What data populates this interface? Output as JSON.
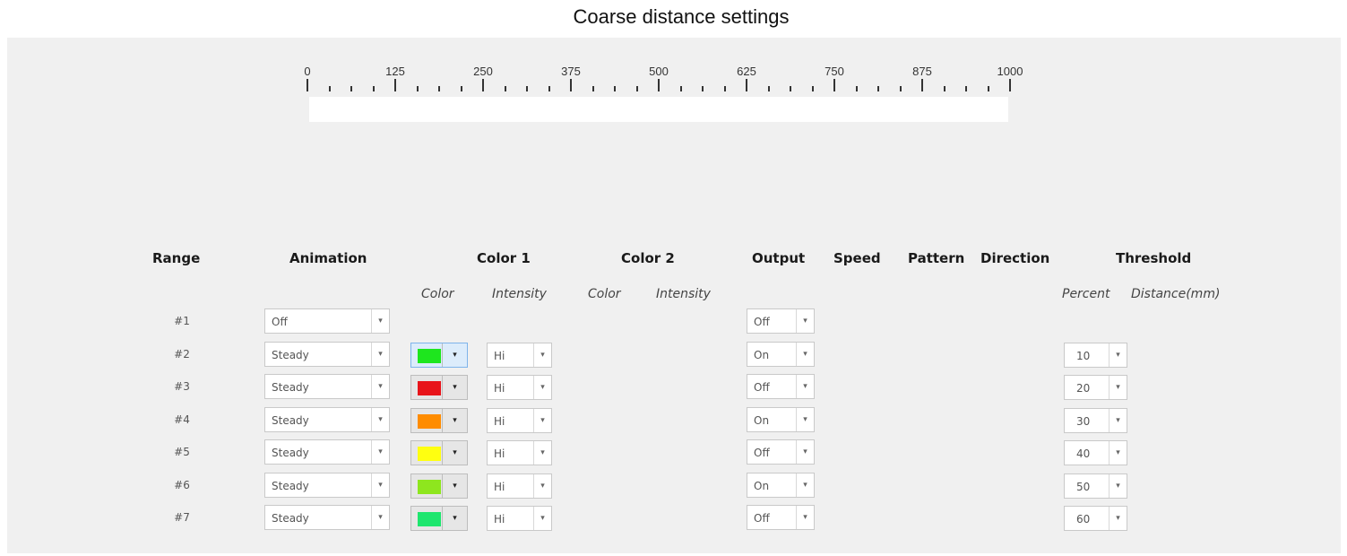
{
  "title": "Coarse distance settings",
  "ruler": {
    "labels": [
      "0",
      "125",
      "250",
      "375",
      "500",
      "625",
      "750",
      "875",
      "1000"
    ],
    "minor_per_major": 3
  },
  "headers": {
    "range": "Range",
    "animation": "Animation",
    "color1": "Color 1",
    "color2": "Color 2",
    "output": "Output",
    "speed": "Speed",
    "pattern": "Pattern",
    "direction": "Direction",
    "threshold": "Threshold"
  },
  "subheaders": {
    "c1_color": "Color",
    "c1_intensity": "Intensity",
    "c2_color": "Color",
    "c2_intensity": "Intensity",
    "percent": "Percent",
    "distance": "Distance(mm)"
  },
  "rows": [
    {
      "label": "#1",
      "animation": "Off",
      "output": "Off"
    },
    {
      "label": "#2",
      "animation": "Steady",
      "color": "#1ee61e",
      "intensity": "Hi",
      "output": "On",
      "percent": "10",
      "active": true
    },
    {
      "label": "#3",
      "animation": "Steady",
      "color": "#e8141a",
      "intensity": "Hi",
      "output": "Off",
      "percent": "20"
    },
    {
      "label": "#4",
      "animation": "Steady",
      "color": "#ff8c00",
      "intensity": "Hi",
      "output": "On",
      "percent": "30"
    },
    {
      "label": "#5",
      "animation": "Steady",
      "color": "#ffff10",
      "intensity": "Hi",
      "output": "Off",
      "percent": "40"
    },
    {
      "label": "#6",
      "animation": "Steady",
      "color": "#8ee61e",
      "intensity": "Hi",
      "output": "On",
      "percent": "50"
    },
    {
      "label": "#7",
      "animation": "Steady",
      "color": "#1ee66e",
      "intensity": "Hi",
      "output": "Off",
      "percent": "60"
    }
  ]
}
